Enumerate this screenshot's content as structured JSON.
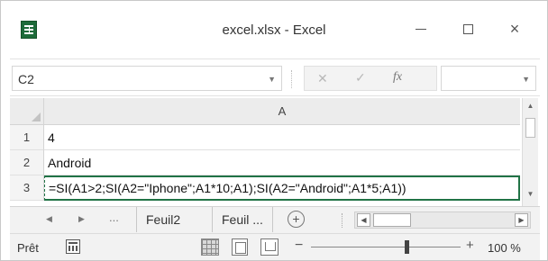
{
  "window": {
    "title": "excel.xlsx - Excel",
    "close_glyph": "×"
  },
  "formula_bar": {
    "name_box": "C2",
    "dropdown_glyph": "▼",
    "cancel_glyph": "✕",
    "enter_glyph": "✓",
    "function_glyph": "fx",
    "formula_value": ""
  },
  "grid": {
    "column_header": "A",
    "rows": [
      {
        "number": "1",
        "value": "4"
      },
      {
        "number": "2",
        "value": "Android"
      },
      {
        "number": "3",
        "value": "=SI(A1>2;SI(A2=\"Iphone\";A1*10;A1);SI(A2=\"Android\";A1*5;A1))"
      }
    ],
    "up_glyph": "▲",
    "down_glyph": "▼"
  },
  "sheet_tabs": {
    "prev_glyph": "◀",
    "next_glyph": "▶",
    "more_label": "...",
    "tabs": [
      "Feuil2",
      "Feuil ..."
    ],
    "add_glyph": "+",
    "scroll_left_glyph": "◀",
    "scroll_right_glyph": "▶"
  },
  "status_bar": {
    "ready_label": "Prêt",
    "zoom_minus": "−",
    "zoom_plus": "+",
    "zoom_level": "100 %",
    "zoom_fraction": 0.63
  },
  "colors": {
    "excel_green": "#1e6b3a",
    "active_cell_border": "#217346"
  }
}
